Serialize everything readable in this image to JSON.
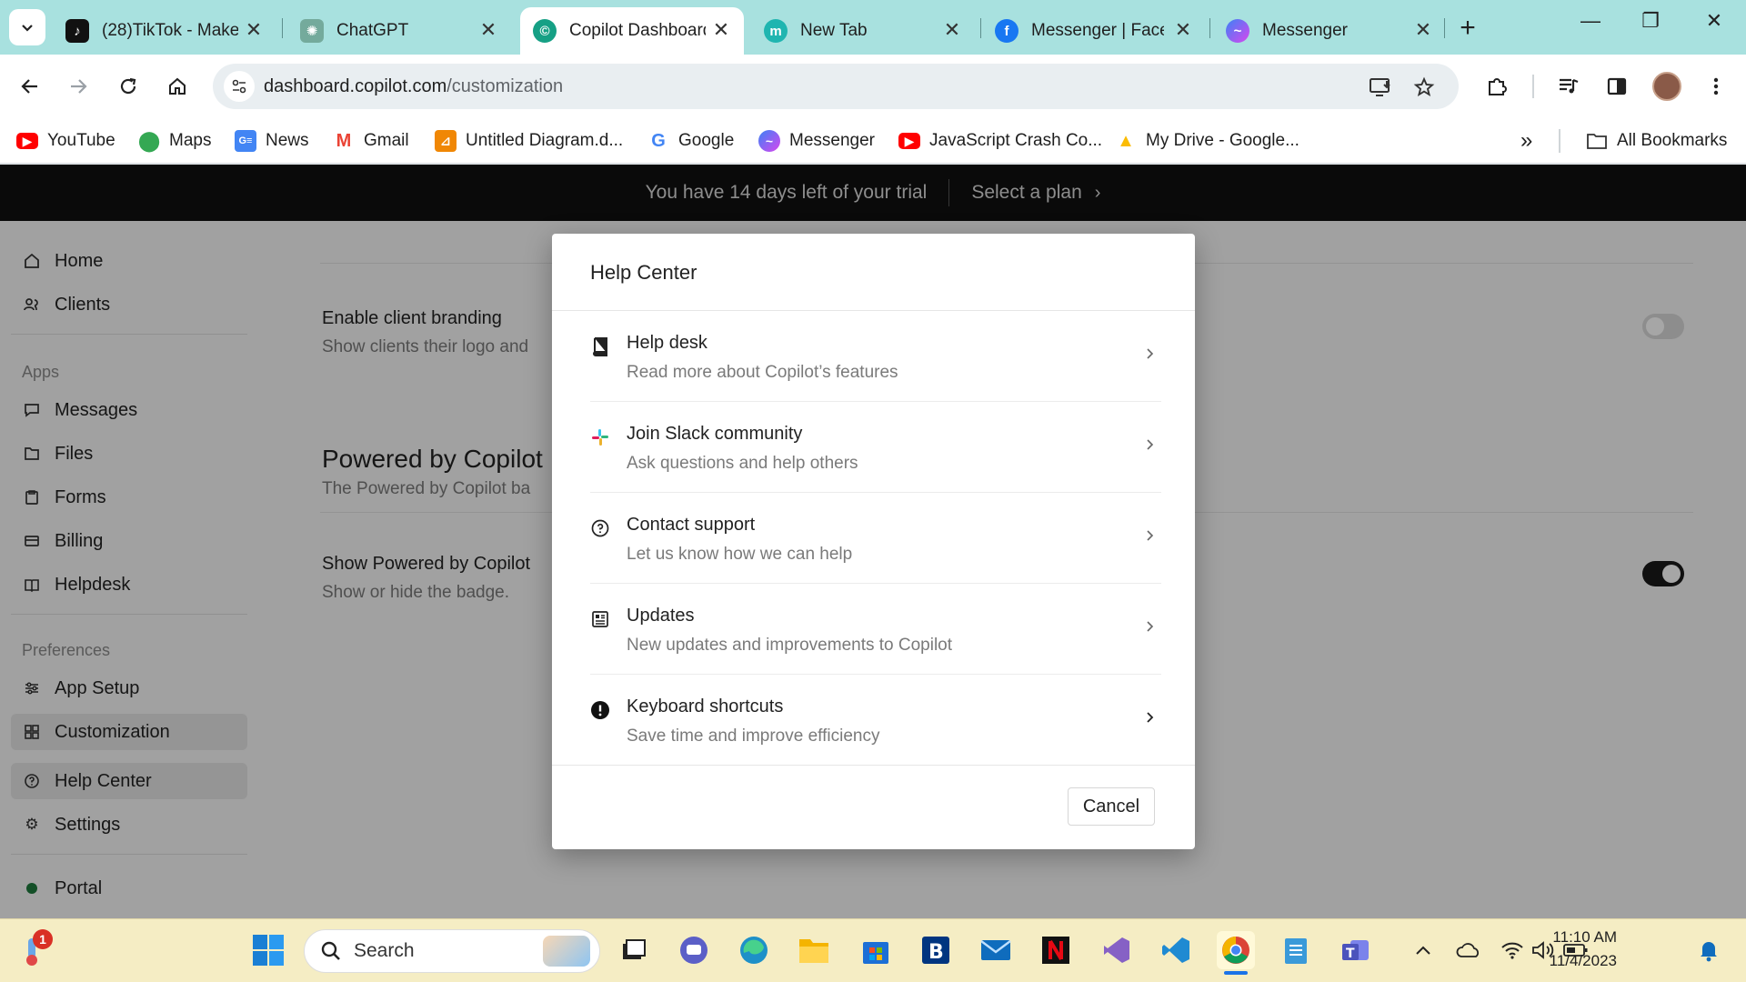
{
  "browser": {
    "tabs": [
      {
        "label": "(28)TikTok - Make",
        "icon": "tiktok-icon",
        "active": false
      },
      {
        "label": "ChatGPT",
        "icon": "chatgpt-icon",
        "active": false
      },
      {
        "label": "Copilot Dashboard",
        "icon": "copilot-icon",
        "active": true
      },
      {
        "label": "New Tab",
        "icon": "new-tab-m-icon",
        "active": false
      },
      {
        "label": "Messenger | Faceb",
        "icon": "facebook-icon",
        "active": false
      },
      {
        "label": "Messenger",
        "icon": "messenger-icon",
        "active": false
      }
    ],
    "close_glyph": "✕",
    "new_tab_glyph": "+",
    "url_host": "dashboard.copilot.com",
    "url_path": "/customization",
    "bookmarks": [
      {
        "label": "YouTube",
        "icon": "youtube-icon"
      },
      {
        "label": "Maps",
        "icon": "maps-icon"
      },
      {
        "label": "News",
        "icon": "news-icon"
      },
      {
        "label": "Gmail",
        "icon": "gmail-icon"
      },
      {
        "label": "Untitled Diagram.d...",
        "icon": "drawio-icon"
      },
      {
        "label": "Google",
        "icon": "google-icon"
      },
      {
        "label": "Messenger",
        "icon": "messenger-icon"
      },
      {
        "label": "JavaScript Crash Co...",
        "icon": "youtube-icon"
      },
      {
        "label": "My Drive - Google...",
        "icon": "drive-icon"
      }
    ],
    "bookmarks_overflow": "»",
    "all_bookmarks": "All Bookmarks"
  },
  "trial": {
    "message": "You have 14 days left of your trial",
    "cta": "Select a plan"
  },
  "sidebar": {
    "items_top": [
      {
        "label": "Home",
        "icon": "home-icon"
      },
      {
        "label": "Clients",
        "icon": "clients-icon"
      }
    ],
    "apps_heading": "Apps",
    "apps": [
      {
        "label": "Messages",
        "icon": "messages-icon"
      },
      {
        "label": "Files",
        "icon": "folder-icon"
      },
      {
        "label": "Forms",
        "icon": "forms-icon"
      },
      {
        "label": "Billing",
        "icon": "billing-icon"
      },
      {
        "label": "Helpdesk",
        "icon": "book-icon"
      }
    ],
    "prefs_heading": "Preferences",
    "prefs": [
      {
        "label": "App Setup",
        "icon": "sliders-icon"
      },
      {
        "label": "Customization",
        "icon": "grid-icon"
      }
    ],
    "bottom": [
      {
        "label": "Help Center",
        "icon": "help-icon"
      },
      {
        "label": "Settings",
        "icon": "gear-icon"
      }
    ],
    "portal": "Portal"
  },
  "content": {
    "branding_title": "Enable client branding",
    "branding_desc": "Show clients their logo and",
    "branding_enabled": false,
    "powered_heading": "Powered by Copilot",
    "powered_desc": "The Powered by Copilot ba",
    "show_powered_title": "Show Powered by Copilot",
    "show_powered_desc": "Show or hide the badge.",
    "show_powered_enabled": true
  },
  "modal": {
    "title": "Help Center",
    "items": [
      {
        "title": "Help desk",
        "desc": "Read more about Copilot’s features",
        "icon": "book-icon"
      },
      {
        "title": "Join Slack community",
        "desc": "Ask questions and help others",
        "icon": "slack-icon"
      },
      {
        "title": "Contact support",
        "desc": "Let us know how we can help",
        "icon": "question-circle-icon"
      },
      {
        "title": "Updates",
        "desc": "New updates and improvements to Copilot",
        "icon": "newspaper-icon"
      },
      {
        "title": "Keyboard shortcuts",
        "desc": "Save time and improve efficiency",
        "icon": "exclamation-circle-icon"
      }
    ],
    "cancel": "Cancel"
  },
  "taskbar": {
    "search_placeholder": "Search",
    "weather_badge": "1",
    "time": "11:10 AM",
    "date": "11/4/2023"
  },
  "colors": {
    "tab_strip": "#a8e1df",
    "trial_bar": "#101010",
    "taskbar": "#f5edc4",
    "toggle_on": "#1a1a1a",
    "toggle_off": "#d9d9d9"
  }
}
